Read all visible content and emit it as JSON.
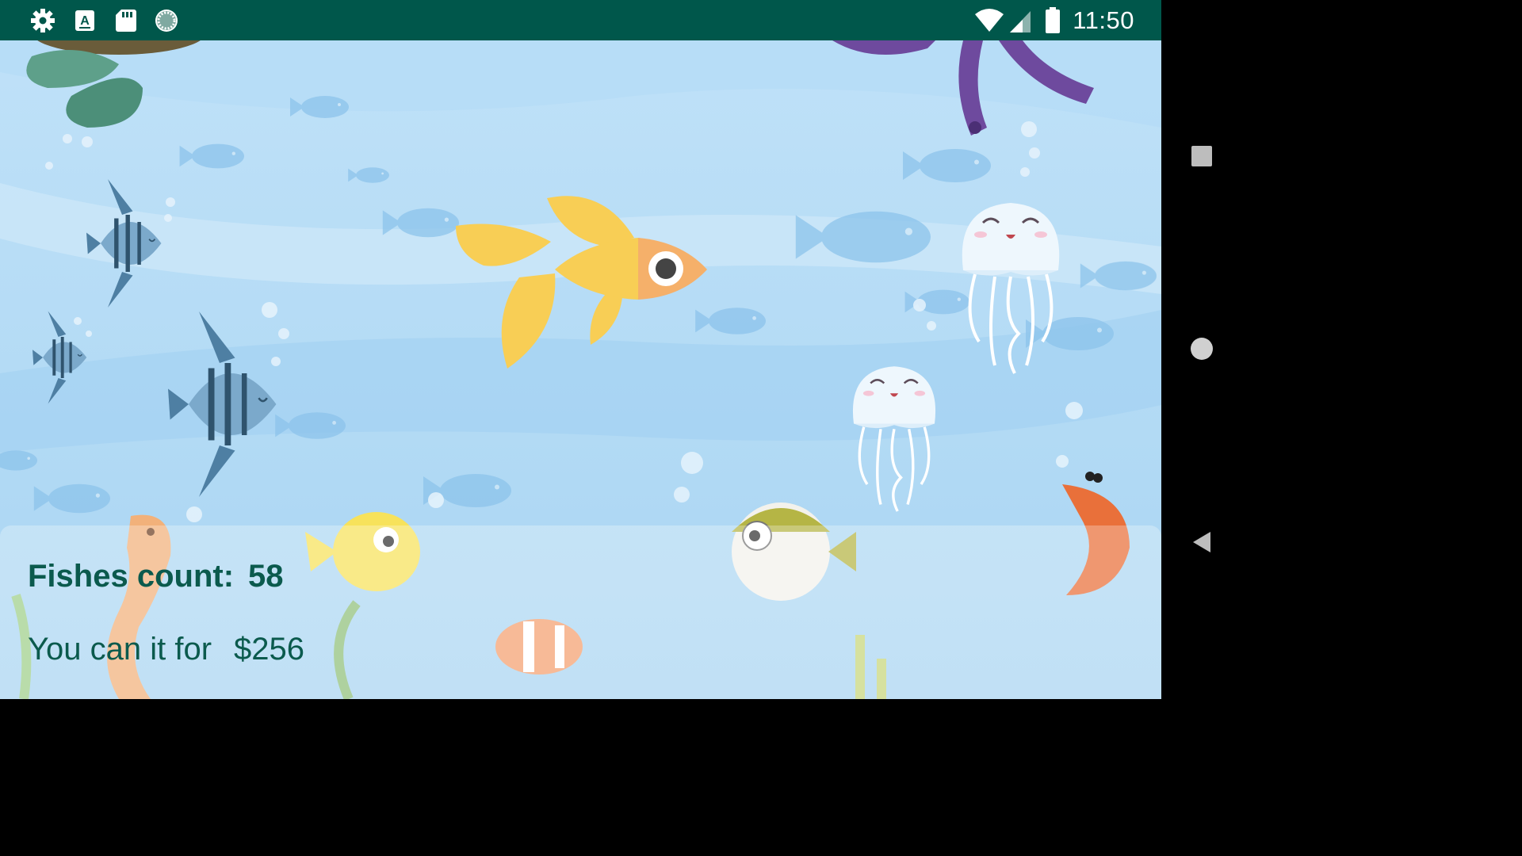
{
  "status_bar": {
    "time": "11:50",
    "left_icons": [
      "gear-icon",
      "keyboard-icon",
      "sd-card-icon",
      "sync-icon"
    ],
    "right_icons": [
      "wifi-icon",
      "signal-icon",
      "battery-icon"
    ],
    "background": "#00574b"
  },
  "main": {
    "fish_count_label": "Fishes count:",
    "fish_count_value": "58",
    "sell_label": "You can it for",
    "sell_value": "$256"
  },
  "nav_bar": {
    "buttons": [
      "recents-button",
      "home-button",
      "back-button"
    ]
  },
  "colors": {
    "ocean_light": "#c8e6f9",
    "ocean_mid": "#a7d4f3",
    "goldfish": "#f8ce55",
    "goldfish_head": "#f5b06a",
    "text": "#0b5a4d"
  }
}
